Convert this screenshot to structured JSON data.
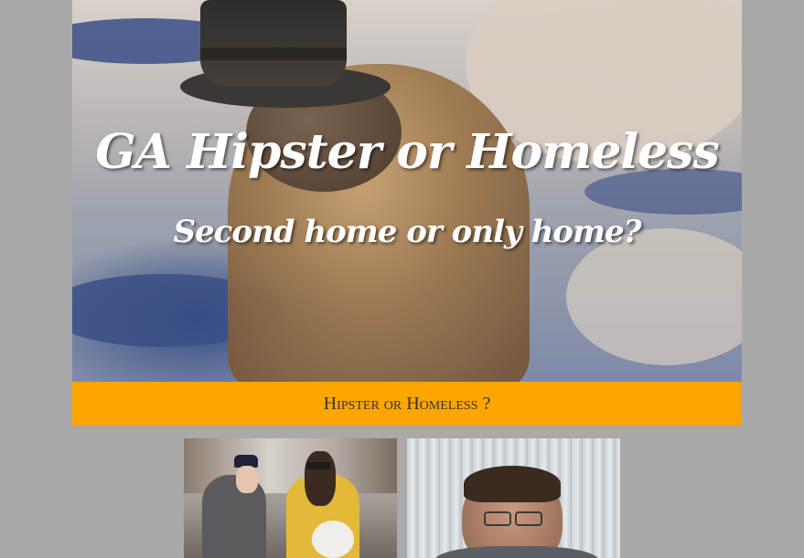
{
  "hero": {
    "title": "GA Hipster or Homeless",
    "subtitle": "Second home or only home?",
    "image_icon": "groundhog-top-hat-image"
  },
  "banner": {
    "text": "Hipster or Homeless ?",
    "background_color": "#ffa500"
  },
  "photos": [
    {
      "icon": "street-musicians-photo"
    },
    {
      "icon": "man-with-glasses-photo"
    }
  ]
}
